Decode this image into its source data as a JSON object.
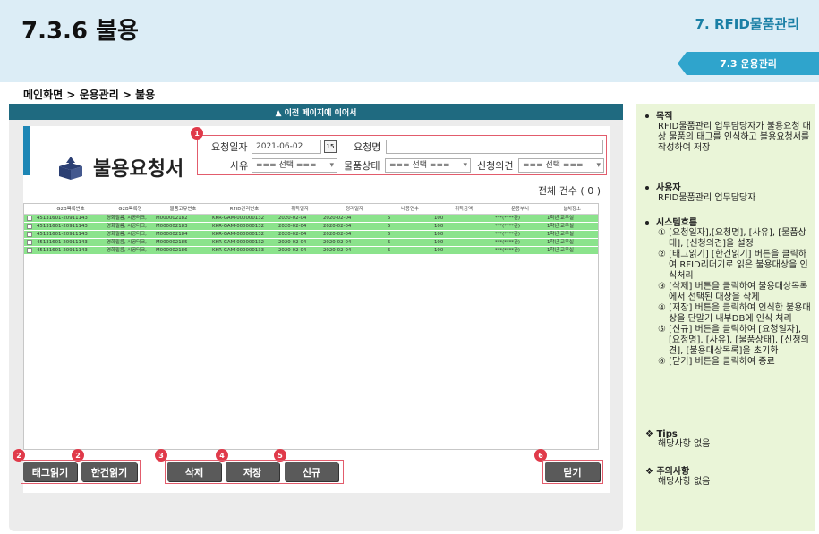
{
  "header": {
    "title": "7.3.6 불용",
    "chapter": "7. RFID물품관리",
    "section": "7.3 운용관리"
  },
  "breadcrumb": "메인화면 > 운용관리 > 불용",
  "continue_bar": "▲ 이전 페이지에 이어서",
  "form": {
    "title": "불용요청서",
    "filters": {
      "date_label": "요청일자",
      "date_value": "2021-06-02",
      "calendar_label": "15",
      "name_label": "요청명",
      "name_value": "",
      "reason_label": "사유",
      "reason_value": "=== 선택 ===",
      "state_label": "물품상태",
      "state_value": "=== 선택 ===",
      "opinion_label": "신청의견",
      "opinion_value": "=== 선택 ==="
    },
    "count_text": "전체 건수 ( 0 )",
    "table": {
      "columns": [
        "G2B목록번호",
        "G2B목록명",
        "물품고유번호",
        "RFID관리번호",
        "취득일자",
        "정리일자",
        "내용연수",
        "취득금액",
        "운용부서",
        "설치장소"
      ],
      "rows": [
        [
          "45131601-20911143",
          "영화필름, 시공터크,",
          "M000002182",
          "KKR-GAM-000000132",
          "2020-02-04",
          "2020-02-04",
          "5",
          "100",
          "***(****관)",
          "1학년 교무실"
        ],
        [
          "45131601-20911143",
          "영화필름, 시공터크,",
          "M000002183",
          "KKR-GAM-000000132",
          "2020-02-04",
          "2020-02-04",
          "5",
          "100",
          "***(****관)",
          "1학년 교무실"
        ],
        [
          "45131601-20911143",
          "영화필름, 시공터크,",
          "M000002184",
          "KKR-GAM-000000132",
          "2020-02-04",
          "2020-02-04",
          "5",
          "100",
          "***(****관)",
          "1학년 교무실"
        ],
        [
          "45131601-20911143",
          "영화필름, 시공터크,",
          "M000002185",
          "KKR-GAM-000000132",
          "2020-02-04",
          "2020-02-04",
          "5",
          "100",
          "***(****관)",
          "1학년 교무실"
        ],
        [
          "45131601-20911143",
          "영화필름, 시공터크,",
          "M000002186",
          "KKR-GAM-000000133",
          "2020-02-04",
          "2020-02-04",
          "5",
          "100",
          "***(****관)",
          "1학년 교무실"
        ]
      ]
    },
    "buttons": {
      "tag_read": "태그읽기",
      "single_read": "한건읽기",
      "delete": "삭제",
      "save": "저장",
      "new": "신규",
      "close": "닫기"
    },
    "badges": [
      "1",
      "2",
      "2",
      "3",
      "4",
      "5",
      "6"
    ]
  },
  "side": {
    "purpose_title": "목적",
    "purpose_body": "RFID물품관리 업무담당자가 불용요청 대상 물품의 태그를 인식하고 불용요청서를 작성하여 저장",
    "user_title": "사용자",
    "user_body": "RFID물품관리 업무담당자",
    "flow_title": "시스템흐름",
    "flow_steps": [
      "① [요청일자],[요청명], [사유], [물품상태], [신청의견]을 설정",
      "② [태그읽기] [한건읽기] 버튼을 클릭하여 RFID리더기로 읽은 불용대상을 인식처리",
      "③ [삭제] 버튼을 클릭하여 불용대상목록에서 선택된 대상을 삭제",
      "④ [저장] 버튼을 클릭하여 인식한 불용대상을 단말기 내부DB에 인식 처리",
      "⑤ [신규] 버튼을 클릭하여 [요청일자], [요청명], [사유], [물품상태], [신청의견], [불용대상목록]을 초기화",
      "⑥ [닫기] 버튼을 클릭하여 종료"
    ],
    "tips_title": "Tips",
    "tips_body": "해당사항 없음",
    "caution_title": "주의사항",
    "caution_body": "해당사항 없음"
  },
  "colors": {
    "header_bg": "#dcedf6",
    "accent_blue": "#1d86b5",
    "row_green": "#8be38c",
    "badge_red": "#e03a4a",
    "button_gray": "#5a5a5a",
    "side_bg": "#eaf5d8"
  },
  "icons": {
    "form": "box-upload-icon",
    "calendar": "calendar-icon",
    "dropdown": "chevron-down-icon"
  }
}
